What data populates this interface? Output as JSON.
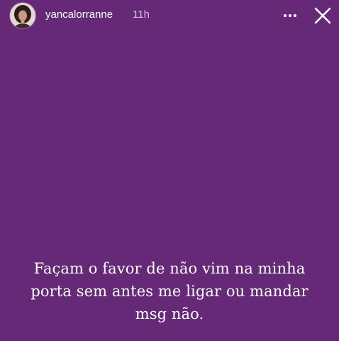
{
  "story": {
    "background_color": "#652977",
    "username": "yancalorranne",
    "time_ago": "11h",
    "caption_lines": [
      "Façam o favor de não vim na minha",
      "porta sem antes me ligar ou mandar",
      "msg não."
    ]
  },
  "icons": {
    "avatar": "profile-photo",
    "more": "more-horizontal-icon",
    "close": "close-icon"
  }
}
